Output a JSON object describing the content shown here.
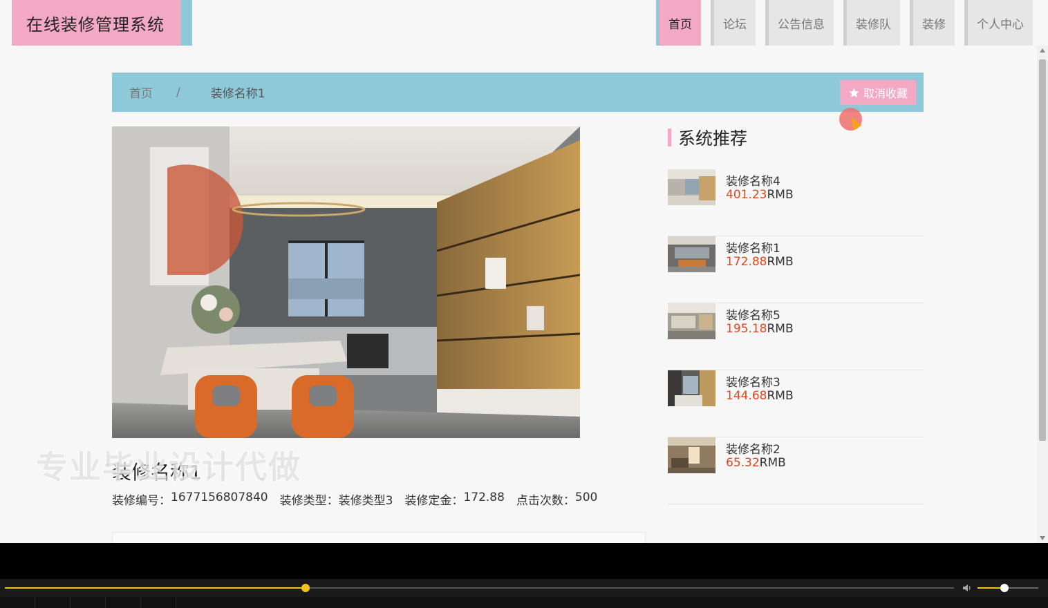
{
  "header": {
    "logo": "在线装修管理系统",
    "nav": [
      {
        "label": "首页",
        "active": true
      },
      {
        "label": "论坛",
        "active": false
      },
      {
        "label": "公告信息",
        "active": false
      },
      {
        "label": "装修队",
        "active": false
      },
      {
        "label": "装修",
        "active": false
      },
      {
        "label": "个人中心",
        "active": false
      }
    ]
  },
  "breadcrumb": {
    "home": "首页",
    "separator": "/",
    "current": "装修名称1",
    "favorite_button": "取消收藏",
    "favorite_icon": "star-icon"
  },
  "detail": {
    "title": "装修名称1",
    "watermark": "专业毕业设计代做",
    "fields": [
      {
        "label": "装修编号：",
        "value": "1677156807840"
      },
      {
        "label": "装修类型：",
        "value": "装修类型3"
      },
      {
        "label": "装修定金：",
        "value": "172.88"
      },
      {
        "label": "点击次数：",
        "value": "500"
      }
    ]
  },
  "recommend": {
    "heading": "系统推荐",
    "items": [
      {
        "name": "装修名称4",
        "price": "401.23",
        "unit": "RMB"
      },
      {
        "name": "装修名称1",
        "price": "172.88",
        "unit": "RMB"
      },
      {
        "name": "装修名称5",
        "price": "195.18",
        "unit": "RMB"
      },
      {
        "name": "装修名称3",
        "price": "144.68",
        "unit": "RMB"
      },
      {
        "name": "装修名称2",
        "price": "65.32",
        "unit": "RMB"
      }
    ]
  },
  "player": {
    "progress_fraction": 0.317,
    "volume_fraction": 0.44,
    "volume_icon": "speaker-icon"
  },
  "colors": {
    "pink": "#f3a8c3",
    "blue": "#8ec9d9",
    "price_red": "#e2451d",
    "progress_yellow": "#f0c419"
  }
}
